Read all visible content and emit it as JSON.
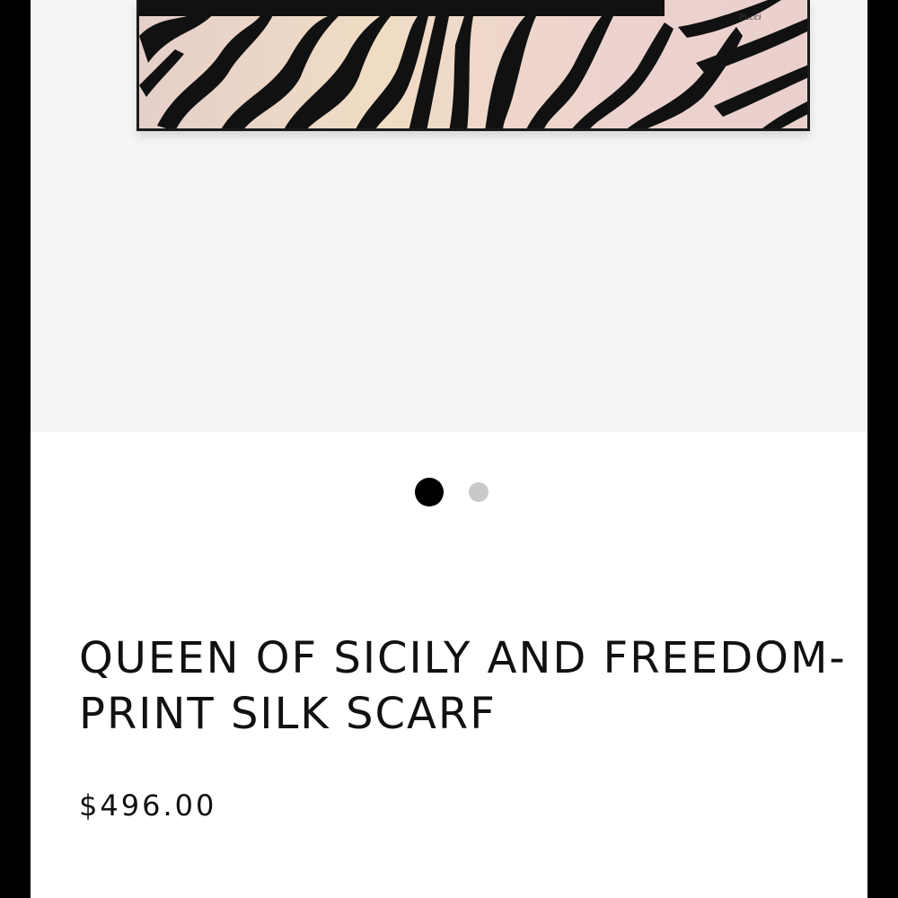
{
  "product": {
    "title": "QUEEN OF SICILY AND FREEDOM-PRINT SILK SCARF",
    "price": "$496.00",
    "image_description_icon": "zebra-print-scarf-image"
  },
  "gallery": {
    "total_images": 2,
    "active_index": 1
  }
}
